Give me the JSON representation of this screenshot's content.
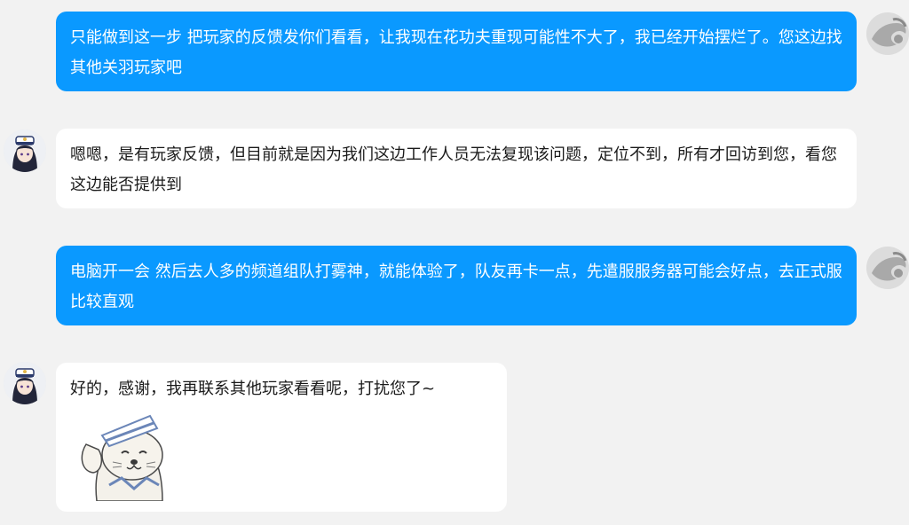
{
  "messages": [
    {
      "sender": "self",
      "text": "只能做到这一步 把玩家的反馈发你们看看，让我现在花功夫重现可能性不大了，我已经开始摆烂了。您这边找其他关羽玩家吧"
    },
    {
      "sender": "support",
      "text": "嗯嗯，是有玩家反馈，但目前就是因为我们这边工作人员无法复现该问题，定位不到，所有才回访到您，看您这边能否提供到"
    },
    {
      "sender": "self",
      "text": "电脑开一会 然后去人多的频道组队打雾神，就能体验了，队友再卡一点，先遣服服务器可能会好点，去正式服比较直观"
    },
    {
      "sender": "support",
      "text": "好的，感谢，我再联系其他玩家看看呢，打扰您了~",
      "sticker": "saluting-otter-sticker"
    }
  ],
  "colors": {
    "outgoing_bubble": "#0a99ff",
    "incoming_bubble": "#ffffff",
    "background": "#f2f2f2"
  }
}
